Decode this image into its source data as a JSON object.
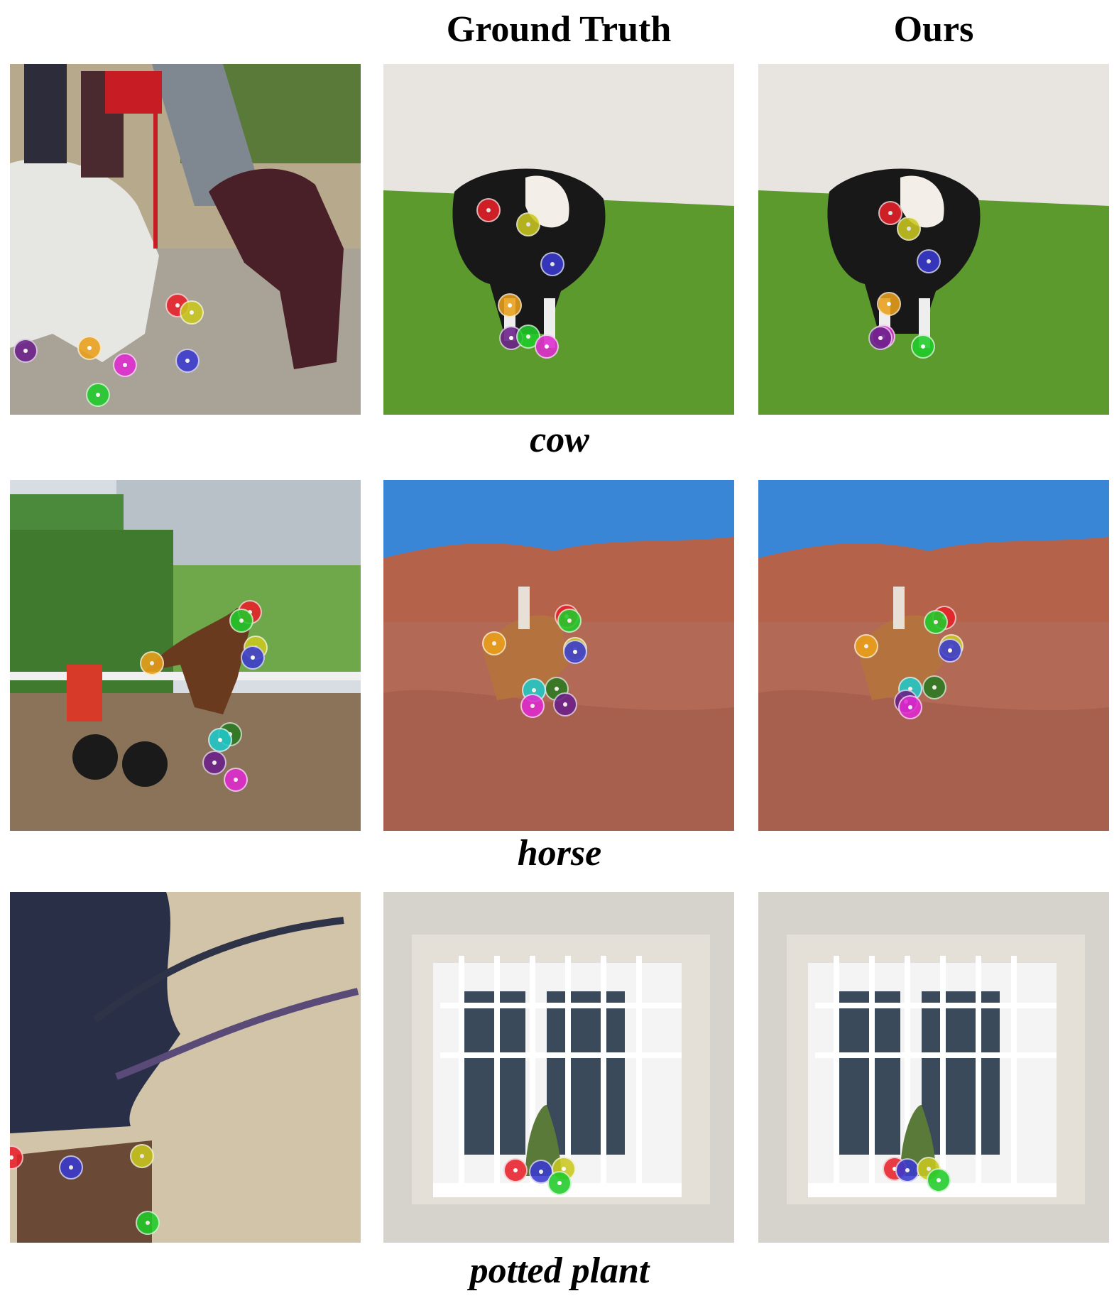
{
  "headers": {
    "ground_truth": "Ground Truth",
    "ours": "Ours"
  },
  "rows": [
    {
      "category": "cow"
    },
    {
      "category": "horse"
    },
    {
      "category": "potted plant"
    }
  ],
  "keypoint_colors": {
    "red": "#e8202a",
    "yellow": "#c9c81f",
    "blue": "#3a3ad0",
    "orange": "#eaa01a",
    "purple": "#6a1f8a",
    "green": "#1fcc2a",
    "magenta": "#e02ad0",
    "cyan": "#1fc9c9",
    "darkgreen": "#2a7a22"
  }
}
